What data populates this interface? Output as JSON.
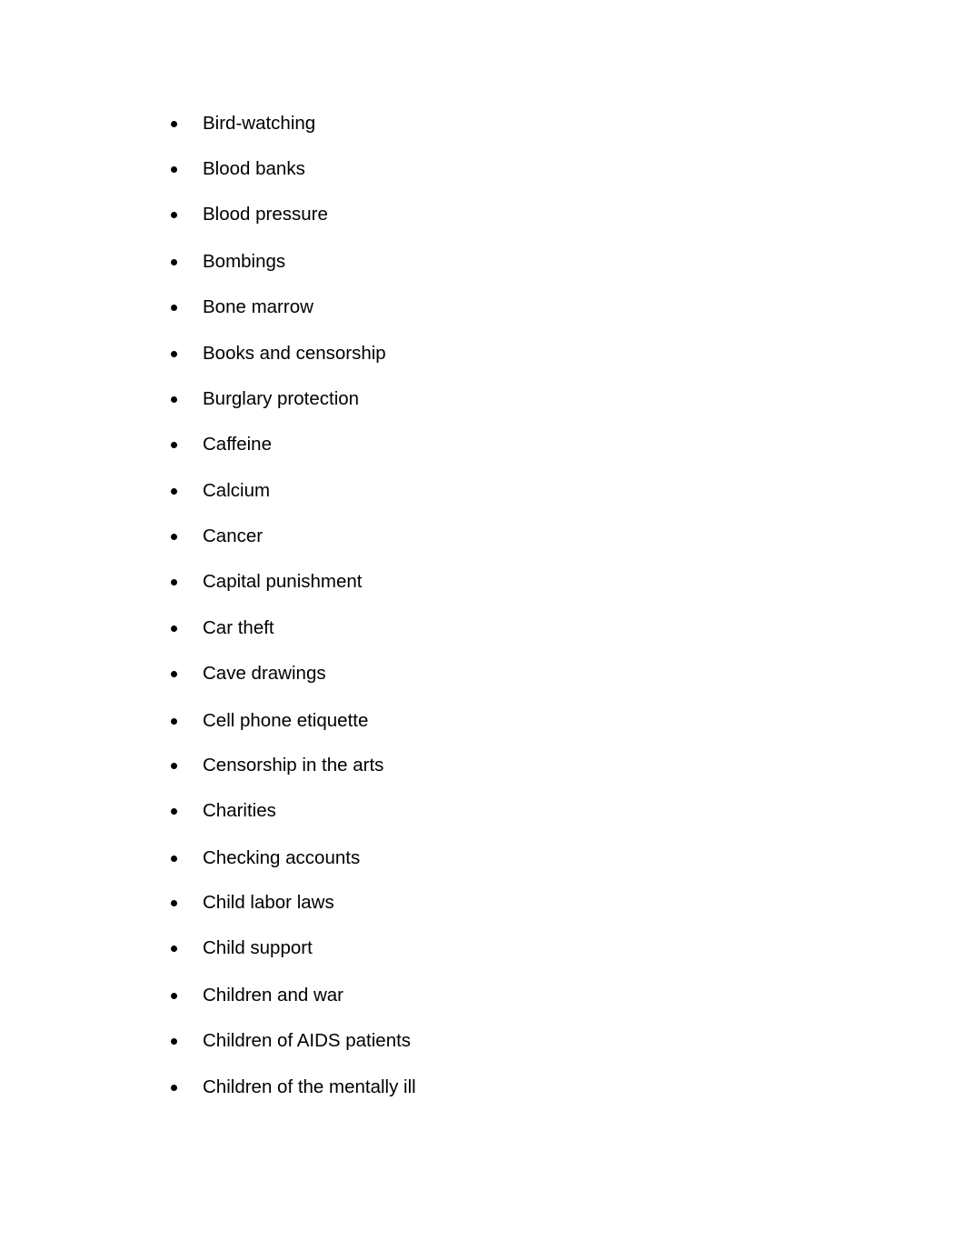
{
  "document": {
    "list": [
      "Bird-watching",
      "Blood banks",
      "Blood pressure",
      "Bombings",
      "Bone marrow",
      "Books and censorship",
      "Burglary protection",
      "Caffeine",
      "Calcium",
      "Cancer",
      "Capital punishment",
      "Car theft",
      "Cave drawings",
      "Cell phone etiquette",
      "Censorship in the arts",
      "Charities",
      "Checking accounts",
      "Child labor laws",
      "Child support",
      "Children and war",
      "Children of AIDS patients",
      "Children of the mentally ill"
    ]
  }
}
